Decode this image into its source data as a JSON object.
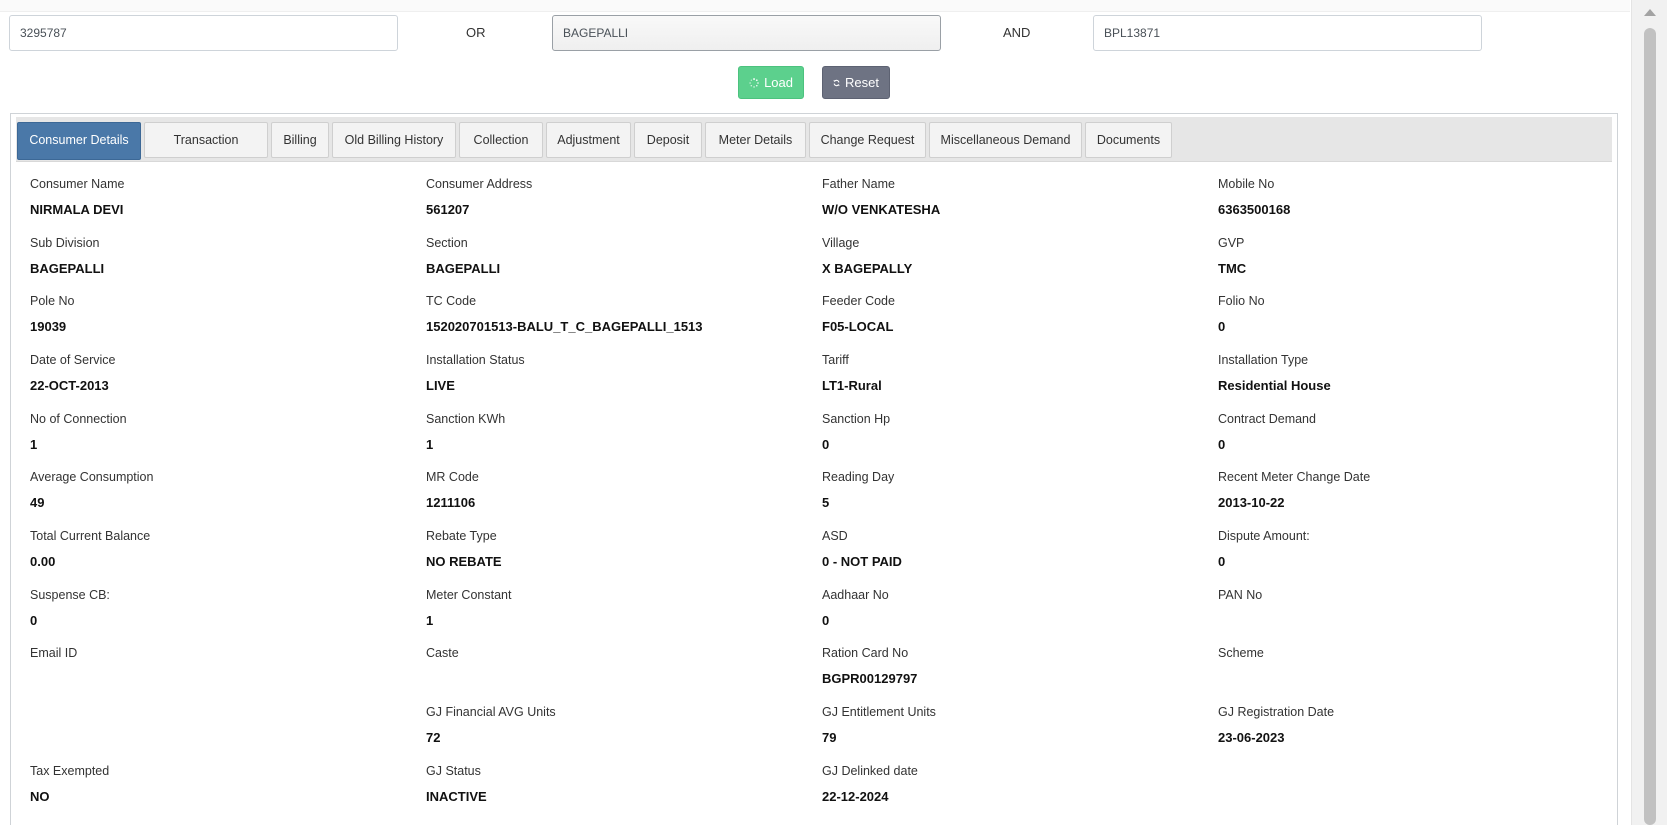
{
  "search": {
    "account_value": "3295787",
    "or_label": "OR",
    "subdivision_value": "BAGEPALLI",
    "and_label": "AND",
    "rr_value": "BPL13871"
  },
  "buttons": {
    "load": "Load",
    "reset": "Reset"
  },
  "tabs": [
    "Consumer Details",
    "Transaction",
    "Billing",
    "Old Billing History",
    "Collection",
    "Adjustment",
    "Deposit",
    "Meter Details",
    "Change Request",
    "Miscellaneous Demand",
    "Documents"
  ],
  "active_tab": "Consumer Details",
  "fields": [
    {
      "label": "Consumer Name",
      "value": "NIRMALA DEVI"
    },
    {
      "label": "Consumer Address",
      "value": "561207"
    },
    {
      "label": "Father Name",
      "value": "W/O VENKATESHA"
    },
    {
      "label": "Mobile No",
      "value": "6363500168"
    },
    {
      "label": "Sub Division",
      "value": "BAGEPALLI"
    },
    {
      "label": "Section",
      "value": "BAGEPALLI"
    },
    {
      "label": "Village",
      "value": "X BAGEPALLY"
    },
    {
      "label": "GVP",
      "value": "TMC"
    },
    {
      "label": "Pole No",
      "value": "19039"
    },
    {
      "label": "TC Code",
      "value": "152020701513-BALU_T_C_BAGEPALLI_1513"
    },
    {
      "label": "Feeder Code",
      "value": "F05-LOCAL"
    },
    {
      "label": "Folio No",
      "value": "0"
    },
    {
      "label": "Date of Service",
      "value": "22-OCT-2013"
    },
    {
      "label": "Installation Status",
      "value": "LIVE"
    },
    {
      "label": "Tariff",
      "value": "LT1-Rural"
    },
    {
      "label": "Installation Type",
      "value": "Residential House"
    },
    {
      "label": "No of Connection",
      "value": "1"
    },
    {
      "label": "Sanction KWh",
      "value": "1"
    },
    {
      "label": "Sanction Hp",
      "value": "0"
    },
    {
      "label": "Contract Demand",
      "value": "0"
    },
    {
      "label": "Average Consumption",
      "value": "49"
    },
    {
      "label": "MR Code",
      "value": "1211106"
    },
    {
      "label": "Reading Day",
      "value": "5"
    },
    {
      "label": "Recent Meter Change Date",
      "value": "2013-10-22"
    },
    {
      "label": "Total Current Balance",
      "value": "0.00"
    },
    {
      "label": "Rebate Type",
      "value": "NO REBATE"
    },
    {
      "label": "ASD",
      "value": "0 - NOT PAID"
    },
    {
      "label": "Dispute Amount:",
      "value": "0"
    },
    {
      "label": "Suspense CB:",
      "value": "0"
    },
    {
      "label": "Meter Constant",
      "value": "1"
    },
    {
      "label": "Aadhaar No",
      "value": "0"
    },
    {
      "label": "PAN No",
      "value": ""
    },
    {
      "label": "Email ID",
      "value": ""
    },
    {
      "label": "Caste",
      "value": ""
    },
    {
      "label": "Ration Card No",
      "value": "BGPR00129797"
    },
    {
      "label": "Scheme",
      "value": ""
    },
    {
      "label": "",
      "value": ""
    },
    {
      "label": "GJ Financial AVG Units",
      "value": "72"
    },
    {
      "label": "GJ Entitlement Units",
      "value": "79"
    },
    {
      "label": "GJ Registration Date",
      "value": "23-06-2023"
    },
    {
      "label": "Tax Exempted",
      "value": "NO"
    },
    {
      "label": "GJ Status",
      "value": "INACTIVE"
    },
    {
      "label": "GJ Delinked date",
      "value": "22-12-2024"
    },
    {
      "label": "",
      "value": ""
    }
  ],
  "colors": {
    "active_tab": "#4a78a8",
    "load_button": "#5cd08d",
    "reset_button": "#6e7383"
  },
  "icons": {
    "load": "spinner-icon",
    "reset": "refresh-icon"
  }
}
